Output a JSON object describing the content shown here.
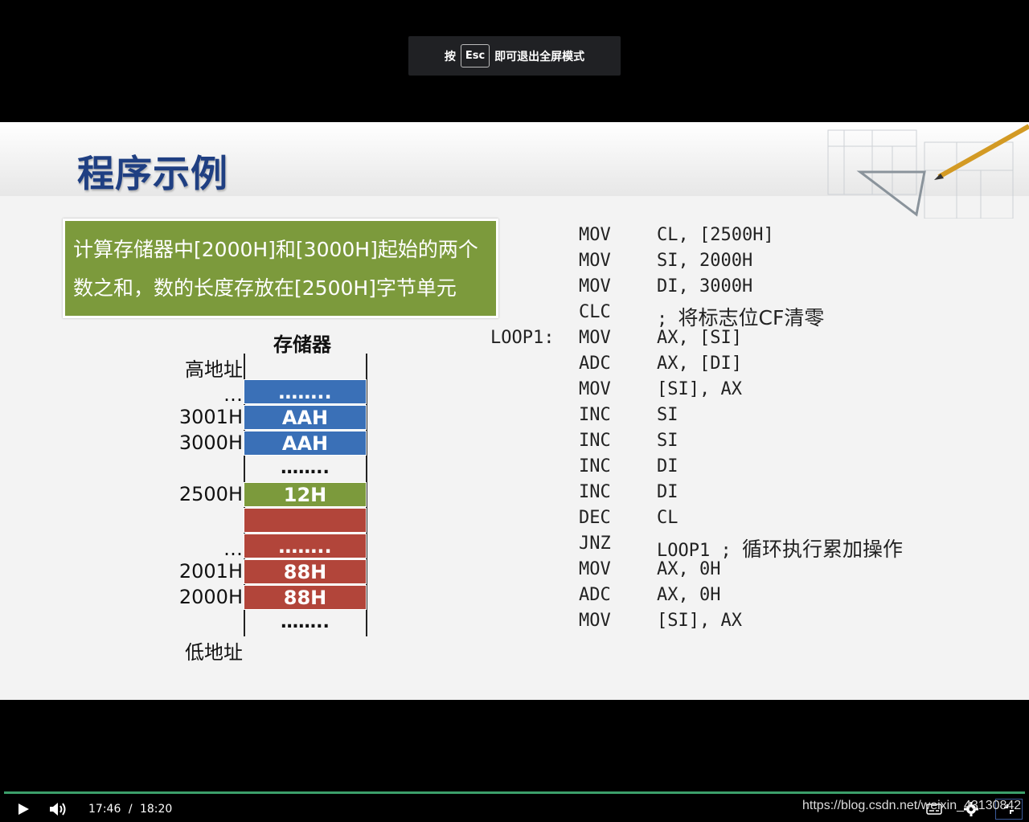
{
  "toast": {
    "prefix": "按",
    "key": "Esc",
    "suffix": "即可退出全屏模式"
  },
  "slide": {
    "title": "程序示例",
    "task_lines": [
      "计算存储器中[2000H]和[3000H]起始的两个",
      "数之和，数的长度存放在[2500H]字节单元"
    ],
    "memory": {
      "title": "存储器",
      "high_label": "高地址",
      "low_label": "低地址",
      "addr_dots_1": "…",
      "addr_3001": "3001H",
      "addr_3000": "3000H",
      "addr_2500": "2500H",
      "addr_dots_2": "…",
      "addr_2001": "2001H",
      "addr_2000": "2000H",
      "cell_dots_top": "……..",
      "cell_3001": "AAH",
      "cell_3000": "AAH",
      "gap_dots_1": "……..",
      "cell_2500": "12H",
      "cell_dots_red": "……..",
      "cell_2001": "88H",
      "cell_2000": "88H",
      "gap_dots_2": "……..",
      "colors": {
        "blue": "#3a70b7",
        "green": "#7c9a3c",
        "red": "#b2453a"
      }
    },
    "code": [
      {
        "label": "",
        "op": "MOV",
        "args": "CL, [2500H]",
        "comment": ""
      },
      {
        "label": "",
        "op": "MOV",
        "args": "SI, 2000H",
        "comment": ""
      },
      {
        "label": "",
        "op": "MOV",
        "args": "DI, 3000H",
        "comment": ""
      },
      {
        "label": "",
        "op": "CLC",
        "args": "; ",
        "comment": "将标志位CF清零"
      },
      {
        "label": "LOOP1:",
        "op": "MOV",
        "args": "AX, [SI]",
        "comment": ""
      },
      {
        "label": "",
        "op": "ADC",
        "args": "AX, [DI]",
        "comment": ""
      },
      {
        "label": "",
        "op": "MOV",
        "args": "[SI], AX",
        "comment": ""
      },
      {
        "label": "",
        "op": "INC",
        "args": "SI",
        "comment": ""
      },
      {
        "label": "",
        "op": "INC",
        "args": "SI",
        "comment": ""
      },
      {
        "label": "",
        "op": "INC",
        "args": "DI",
        "comment": ""
      },
      {
        "label": "",
        "op": "INC",
        "args": "DI",
        "comment": ""
      },
      {
        "label": "",
        "op": "DEC",
        "args": "CL",
        "comment": ""
      },
      {
        "label": "",
        "op": "JNZ",
        "args": "LOOP1 ; ",
        "comment": "循环执行累加操作"
      },
      {
        "label": "",
        "op": "MOV",
        "args": "AX, 0H",
        "comment": ""
      },
      {
        "label": "",
        "op": "ADC",
        "args": "AX, 0H",
        "comment": ""
      },
      {
        "label": "",
        "op": "MOV",
        "args": "[SI], AX",
        "comment": ""
      }
    ]
  },
  "player": {
    "current_time": "17:46",
    "separator": "/",
    "duration": "18:20",
    "progress": 0.968,
    "icons": [
      "play-icon",
      "volume-icon",
      "subtitles-icon",
      "settings-icon",
      "fullscreen-exit-icon"
    ],
    "watermark": "https://blog.csdn.net/weixin_43130842",
    "accent": "#3c9f6a"
  }
}
